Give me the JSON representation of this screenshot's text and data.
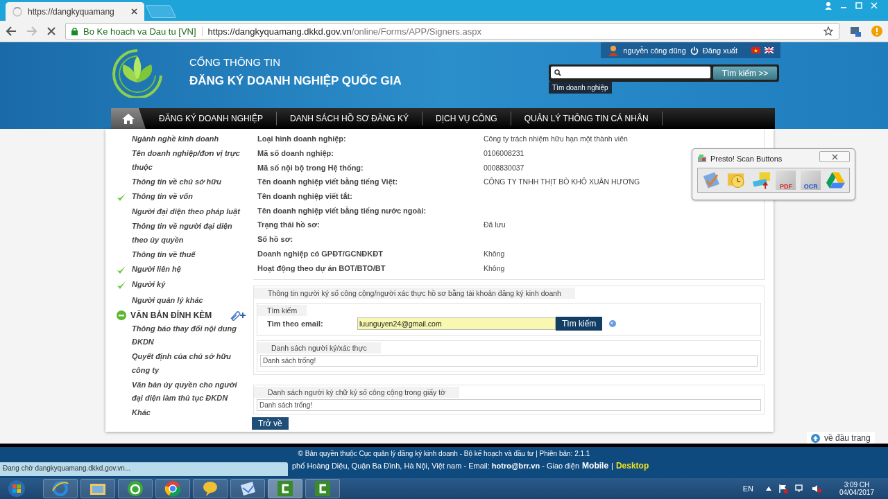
{
  "browser": {
    "tab_title": "https://dangkyquamang",
    "site_label": "Bo Ke hoach va Dau tu [VN]",
    "url_host": "https://dangkyquamang.dkkd.gov.vn",
    "url_path": "/online/Forms/APP/Signers.aspx"
  },
  "header": {
    "subtitle": "CỔNG THÔNG TIN",
    "title": "ĐĂNG KÝ DOANH NGHIỆP QUỐC GIA",
    "user": "nguyễn công dũng",
    "logout": "Đăng xuất",
    "search_button": "Tìm kiếm >>",
    "search_tooltip": "Tìm doanh nghiệp"
  },
  "nav": [
    {
      "label": "ĐĂNG KÝ DOANH NGHIỆP"
    },
    {
      "label": "DANH SÁCH HỒ SƠ ĐĂNG KÝ"
    },
    {
      "label": "DỊCH VỤ CÔNG"
    },
    {
      "label": "QUẢN LÝ THÔNG TIN CÁ NHÂN"
    }
  ],
  "sidebar": [
    {
      "kind": "item",
      "label": "Ngành nghề kinh doanh",
      "checked": false
    },
    {
      "kind": "item",
      "label": "Tên doanh nghiệp/đơn vị trực thuộc",
      "checked": false
    },
    {
      "kind": "item",
      "label": "Thông tin về chủ sở hữu",
      "checked": false
    },
    {
      "kind": "item",
      "label": "Thông tin về vốn",
      "checked": true
    },
    {
      "kind": "item",
      "label": "Người đại diện theo pháp luật",
      "checked": false
    },
    {
      "kind": "item",
      "label": "Thông tin về người đại diện theo ủy quyền",
      "checked": false
    },
    {
      "kind": "item",
      "label": "Thông tin về thuế",
      "checked": false
    },
    {
      "kind": "item",
      "label": "Người liên hệ",
      "checked": true
    },
    {
      "kind": "item",
      "label": "Người ký",
      "checked": true
    },
    {
      "kind": "item",
      "label": "Người quản lý khác",
      "checked": false
    },
    {
      "kind": "section",
      "label": "VĂN BẢN ĐÍNH KÈM"
    },
    {
      "kind": "item",
      "label": "Thông báo thay đổi nội dung ĐKDN",
      "checked": false
    },
    {
      "kind": "item",
      "label": "Quyết định của chủ sở hữu công ty",
      "checked": false
    },
    {
      "kind": "item",
      "label": "Văn bản ủy quyền cho người đại diện làm thủ tục ĐKDN",
      "checked": false
    },
    {
      "kind": "item",
      "label": "Khác",
      "checked": false
    }
  ],
  "details": [
    {
      "label": "Loại hình doanh nghiệp:",
      "value": "Công ty trách nhiệm hữu hạn một thành viên"
    },
    {
      "label": "Mã số doanh nghiệp:",
      "value": "0106008231"
    },
    {
      "label": "Mã số nội bộ trong Hệ thống:",
      "value": "0008830037"
    },
    {
      "label": "Tên doanh nghiệp viết bằng tiếng Việt:",
      "value": "CÔNG TY TNHH THỊT BÒ KHÔ XUÂN HƯƠNG"
    },
    {
      "label": "Tên doanh nghiệp viết tắt:"
    },
    {
      "label": "Tên doanh nghiệp viết bằng tiếng nước ngoài:"
    },
    {
      "label": "Trạng thái hồ sơ:",
      "value": "Đã lưu"
    },
    {
      "label": "Số hồ sơ:"
    },
    {
      "label": "Doanh nghiệp có GPĐT/GCNĐKĐT",
      "value": "Không"
    },
    {
      "label": "Hoạt động theo dự án BOT/BTO/BT",
      "value": "Không"
    }
  ],
  "signers": {
    "legend": "Thông tin người ký số công cộng/người xác thực hồ sơ bằng tài khoản đăng ký kinh doanh",
    "search_legend": "Tìm kiếm",
    "email_label": "Tìm theo email:",
    "email_value": "luunguyen24@gmail.com",
    "search_button": "Tìm kiếm",
    "list_legend": "Danh sách người ký/xác thực",
    "list_empty": "Danh sách trống!"
  },
  "documents": {
    "legend": "Danh sách người ký chữ ký số công cộng trong giấy tờ",
    "empty": "Danh sách trống!"
  },
  "back_button": "Trở về",
  "scan_popup": {
    "title": "Presto! Scan Buttons",
    "buttons": [
      {
        "kind": "check"
      },
      {
        "kind": "mail"
      },
      {
        "kind": "scan"
      },
      {
        "kind": "doc",
        "text": "PDF",
        "color": "#e02020"
      },
      {
        "kind": "doc",
        "text": "OCR",
        "color": "#2050d0"
      },
      {
        "kind": "drive"
      }
    ]
  },
  "back_to_top": "về đầu trang",
  "footer": {
    "line1": "© Bản quyền thuộc Cục quản lý đăng ký kinh doanh - Bộ kế hoạch và đầu tư | Phiên bản: 2.1.1",
    "line2": "phố Hoàng Diệu, Quận Ba Đình, Hà Nội, Việt nam - Email: **hotro@brr.vn** - Giao diện",
    "mobile": "Mobile",
    "separator": "|",
    "desktop": "Desktop"
  },
  "status": "Đang chờ dangkyquamang.dkkd.gov.vn...",
  "taskbar": {
    "apps": [
      {
        "kind": "ie"
      },
      {
        "kind": "folder"
      },
      {
        "kind": "green"
      },
      {
        "kind": "chrome"
      },
      {
        "kind": "chat"
      },
      {
        "kind": "mail"
      },
      {
        "kind": "camtasia",
        "selected": true
      },
      {
        "kind": "camtasia",
        "selected": false
      }
    ],
    "language": "EN",
    "time": "3:09 CH",
    "date": "04/04/2017"
  }
}
